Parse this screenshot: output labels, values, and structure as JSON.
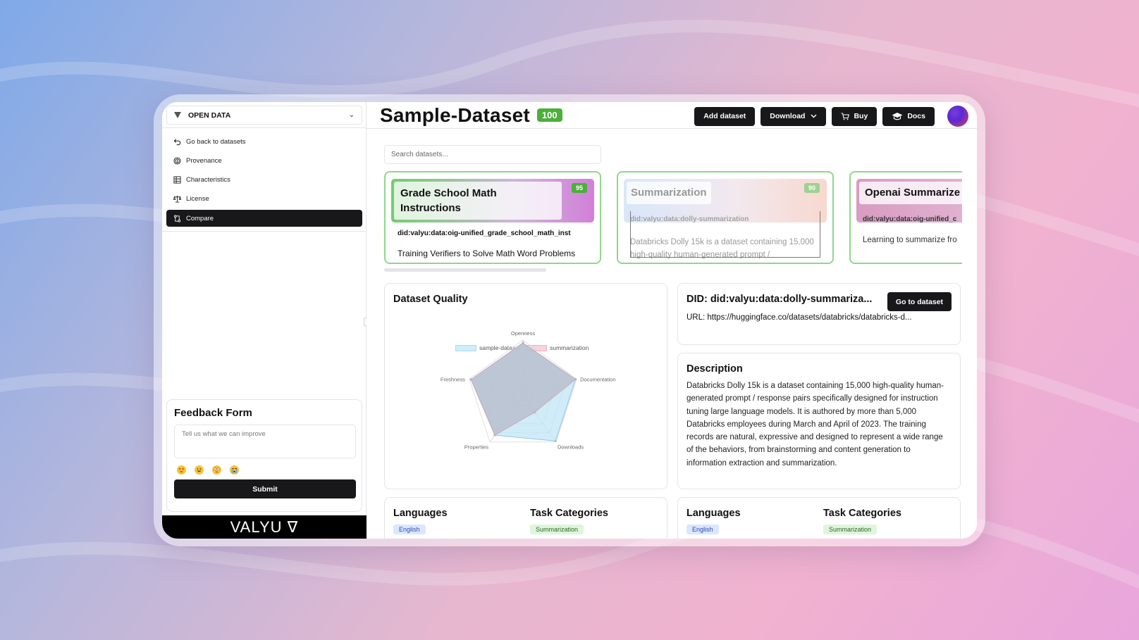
{
  "sidebar": {
    "workspace": "OPEN DATA",
    "items": [
      {
        "label": "Go back to datasets",
        "icon": "back-arrow-icon"
      },
      {
        "label": "Provenance",
        "icon": "fingerprint-icon"
      },
      {
        "label": "Characteristics",
        "icon": "table-icon"
      },
      {
        "label": "License",
        "icon": "scale-icon"
      },
      {
        "label": "Compare",
        "icon": "compare-icon",
        "active": true
      }
    ],
    "feedback": {
      "title": "Feedback Form",
      "placeholder": "Tell us what we can improve",
      "emojis": [
        "star-struck-emoji",
        "grinning-emoji",
        "flushed-emoji",
        "crying-emoji"
      ],
      "submit_label": "Submit"
    },
    "brand": "VALYU ∇"
  },
  "header": {
    "title": "Sample-Dataset",
    "score": "100",
    "buttons": {
      "add_dataset": "Add dataset",
      "download": "Download",
      "buy": "Buy",
      "docs": "Docs"
    }
  },
  "search": {
    "placeholder": "Search datasets..."
  },
  "cards": [
    {
      "name": "Grade School Math Instructions",
      "score": "95",
      "did": "did:valyu:data:oig-unified_grade_school_math_inst",
      "description": "Training Verifiers to Solve Math Word Problems"
    },
    {
      "name": "Summarization",
      "score": "90",
      "did": "did:valyu:data:dolly-summarization",
      "description": "Databricks Dolly 15k is a dataset containing 15,000 high-quality human-generated prompt /"
    },
    {
      "name": "Openai Summarize",
      "score": "",
      "did": "did:valyu:data:oig-unified_c",
      "description": "Learning to summarize fro"
    }
  ],
  "quality": {
    "title": "Dataset Quality"
  },
  "chart_data": {
    "type": "radar",
    "categories": [
      "Openness",
      "Documentation",
      "Downloads",
      "Properties",
      "Freshness"
    ],
    "series": [
      {
        "name": "sample-dataset",
        "values": [
          0.95,
          0.98,
          0.98,
          0.85,
          0.97
        ],
        "color": "#bfe6f6"
      },
      {
        "name": "summarization",
        "values": [
          0.95,
          0.98,
          0.35,
          0.85,
          0.97
        ],
        "color": "#f4c6d2"
      }
    ],
    "range": [
      0,
      1
    ]
  },
  "detail": {
    "did": "DID: did:valyu:data:dolly-summariza...",
    "go_label": "Go to dataset",
    "url": "URL: https://huggingface.co/datasets/databricks/databricks-d...",
    "description_title": "Description",
    "description": "Databricks Dolly 15k is a dataset containing 15,000 high-quality human-generated prompt / response pairs specifically designed for instruction tuning large language models. It is authored by more than 5,000 Databricks employees during March and April of 2023. The training records are natural, expressive and designed to represent a wide range of the behaviors, from brainstorming and content generation to information extraction and summarization."
  },
  "bottom": {
    "left": {
      "languages": "Languages",
      "task_categories": "Task Categories",
      "language_chip": "English",
      "task_chip": "Summarization"
    },
    "right": {
      "languages": "Languages",
      "task_categories": "Task Categories",
      "language_chip": "English",
      "task_chip": "Summarization"
    }
  },
  "colors": {
    "accent": "#18181b",
    "score_green": "#4caf3a",
    "card_border": "#8fd88a"
  }
}
